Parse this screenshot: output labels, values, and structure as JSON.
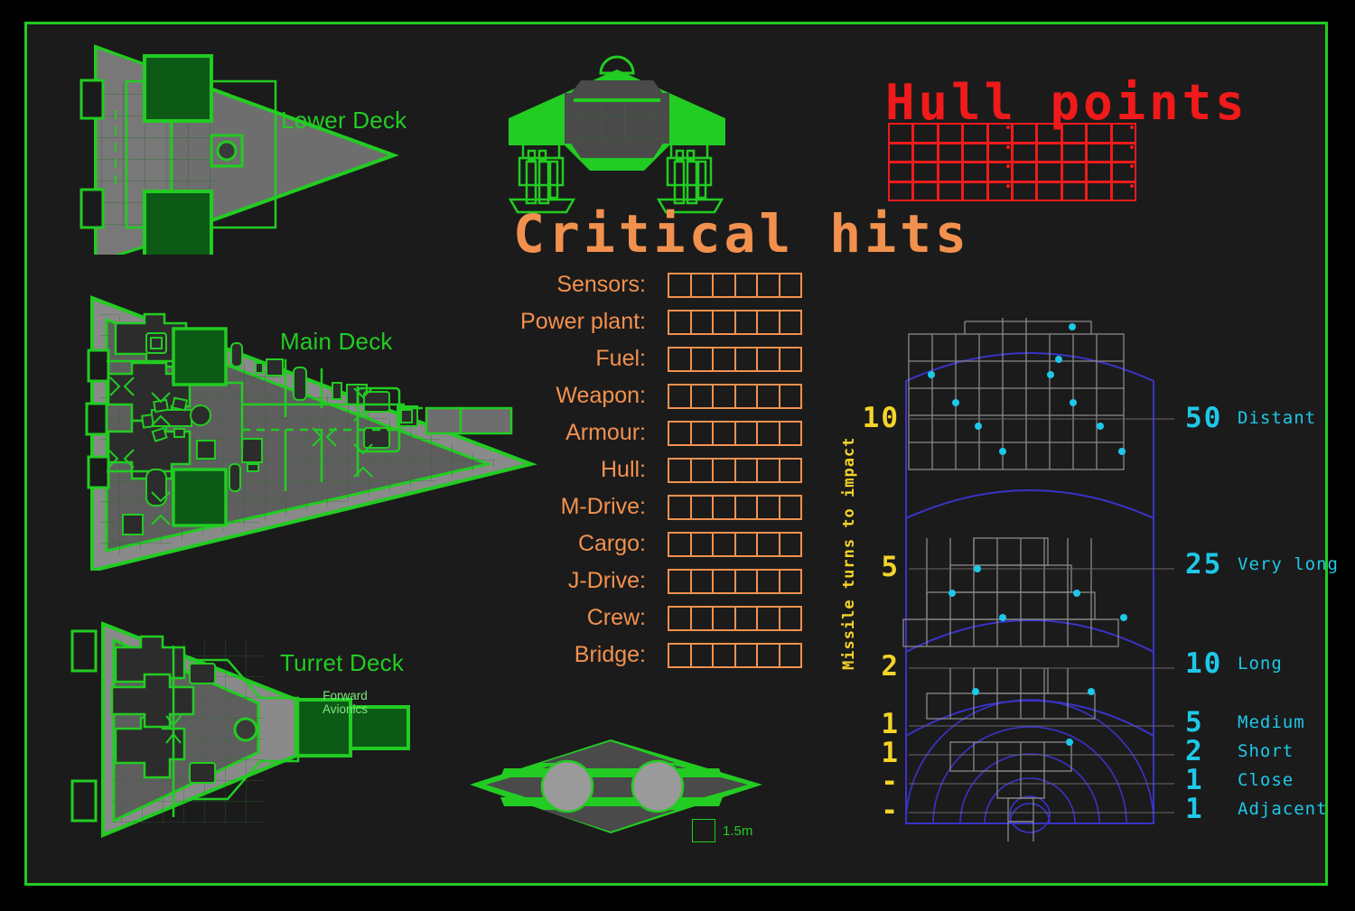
{
  "sheet": {
    "background": "#1b1b1b",
    "border_color": "#22cc22",
    "accent_green": "#22cc22",
    "accent_orange": "#f2914e",
    "accent_red": "#f01a1a",
    "accent_cyan": "#1ec8e8",
    "accent_yellow": "#f5d429",
    "accent_blue": "#3a33c8"
  },
  "decks": [
    {
      "label": "Lower Deck"
    },
    {
      "label": "Main Deck"
    },
    {
      "label": "Turret Deck"
    }
  ],
  "turret_deck": {
    "forward_avionics_line1": "Forward",
    "forward_avionics_line2": "Avionics"
  },
  "scale": {
    "value": "1.5m"
  },
  "critical_hits": {
    "title": "Critical hits",
    "boxes_per_row": 6,
    "rows": [
      {
        "label": "Sensors:"
      },
      {
        "label": "Power plant:"
      },
      {
        "label": "Fuel:"
      },
      {
        "label": "Weapon:"
      },
      {
        "label": "Armour:"
      },
      {
        "label": "Hull:"
      },
      {
        "label": "M-Drive:"
      },
      {
        "label": "Cargo:"
      },
      {
        "label": "J-Drive:"
      },
      {
        "label": "Crew:"
      },
      {
        "label": "Bridge:"
      }
    ]
  },
  "hull_points": {
    "title": "Hull points",
    "columns": 10,
    "rows": 4,
    "marked_columns": [
      5,
      10
    ]
  },
  "chart_data": {
    "type": "scatter",
    "title": "Missile turns to impact",
    "ylabel": "Missile turns to impact",
    "turns_axis": [
      "10",
      "5",
      "2",
      "1",
      "1",
      "-",
      "-"
    ],
    "range_values": [
      "50",
      "25",
      "10",
      "5",
      "2",
      "1",
      "1"
    ],
    "range_names": [
      "Distant",
      "Very long",
      "Long",
      "Medium",
      "Short",
      "Close",
      "Adjacent"
    ],
    "bands": [
      {
        "name": "Distant",
        "turns": "10",
        "range": "50",
        "cols": 9,
        "rows": 5,
        "dots": 9
      },
      {
        "name": "Very long",
        "turns": "5",
        "range": "25",
        "cols": 9,
        "rows": 4,
        "dots": 5
      },
      {
        "name": "Long",
        "turns": "2",
        "range": "10",
        "cols": 7,
        "rows": 2,
        "dots": 2
      },
      {
        "name": "Medium",
        "turns": "1",
        "range": "5",
        "cols": 5,
        "rows": 1,
        "dots": 1
      },
      {
        "name": "Short",
        "turns": "1",
        "range": "2",
        "cols": 2,
        "rows": 1,
        "dots": 0
      },
      {
        "name": "Close",
        "turns": "-",
        "range": "1",
        "cols": 1,
        "rows": 1,
        "dots": 0
      },
      {
        "name": "Adjacent",
        "turns": "-",
        "range": "1",
        "cols": 1,
        "rows": 1,
        "dots": 0
      }
    ],
    "dot_color": "#1ec8e8",
    "grid_color": "#8a8a8a",
    "arc_color": "#3a33c8",
    "legend_position": "right"
  }
}
